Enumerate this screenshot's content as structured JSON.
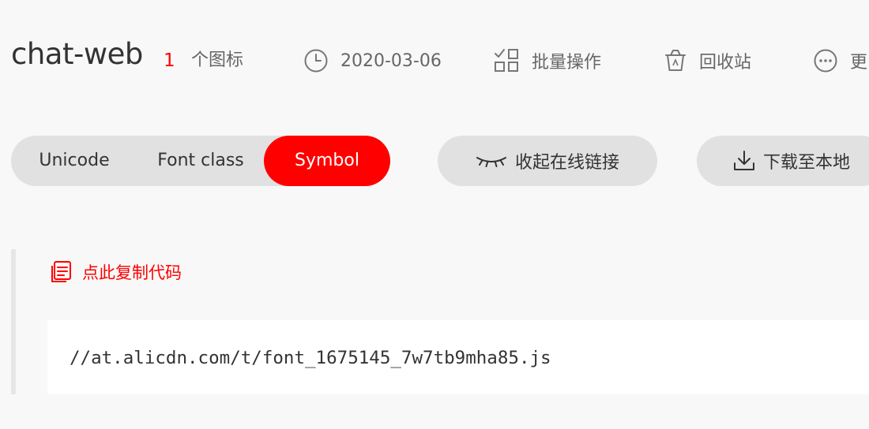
{
  "project": {
    "name": "chat-web",
    "icon_count": "1",
    "icon_count_label": "个图标"
  },
  "header_actions": {
    "date": {
      "icon": "clock-icon",
      "label": "2020-03-06"
    },
    "batch": {
      "icon": "grid-check-icon",
      "label": "批量操作"
    },
    "recycle": {
      "icon": "trash-icon",
      "label": "回收站"
    },
    "more": {
      "icon": "more-dots-icon",
      "label": "更"
    }
  },
  "tabs": [
    {
      "label": "Unicode",
      "active": false
    },
    {
      "label": "Font class",
      "active": false
    },
    {
      "label": "Symbol",
      "active": true
    }
  ],
  "buttons": {
    "collapse_link": {
      "icon": "closed-eye-icon",
      "label": "收起在线链接"
    },
    "download": {
      "icon": "download-icon",
      "label": "下载至本地"
    }
  },
  "code": {
    "copy_label": "点此复制代码",
    "copy_icon": "copy-document-icon",
    "url": "//at.alicdn.com/t/font_1675145_7w7tb9mha85.js"
  },
  "colors": {
    "accent": "#ff0000",
    "pill_bg": "#e1e1e1",
    "page_bg": "#f8f8f8"
  }
}
